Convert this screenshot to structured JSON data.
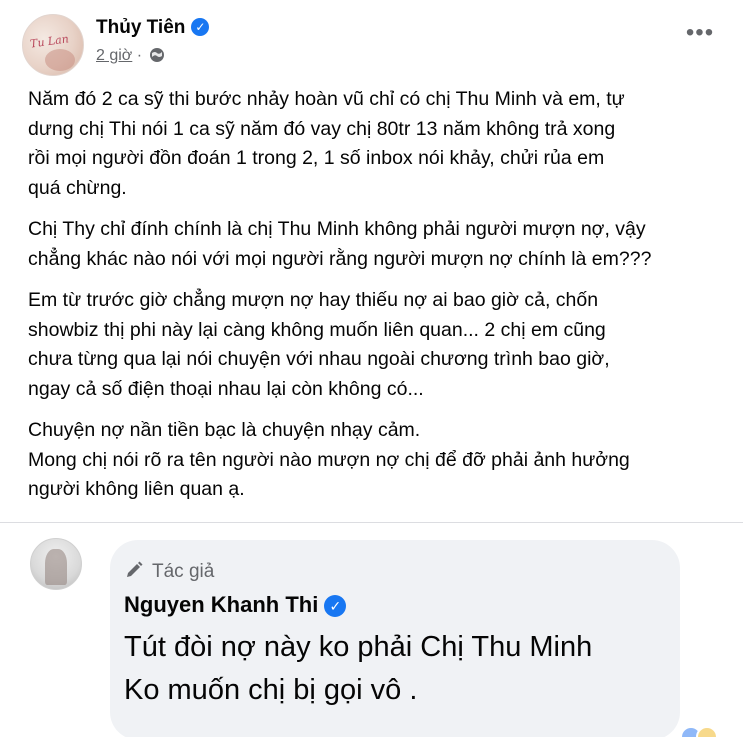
{
  "post": {
    "author": "Thủy Tiên",
    "time": "2 giờ",
    "separator": "·",
    "avatar_text": "Tu Lan",
    "paragraphs": [
      "Năm đó 2 ca sỹ thi bước nhảy hoàn vũ chỉ có chị Thu Minh và em, tự\ndưng chị Thi nói 1 ca sỹ năm đó vay chị 80tr 13 năm không trả xong\nrồi mọi người đồn đoán 1 trong 2, 1 số inbox nói khảy, chửi rủa em\nquá chừng.",
      "Chị Thy chỉ đính chính là chị Thu Minh không phải người mượn nợ, vậy\nchẳng khác nào nói với mọi người rằng người mượn nợ chính là em???",
      "Em từ trước giờ chẳng mượn nợ hay thiếu nợ ai bao giờ cả, chốn\nshowbiz thị phi này lại càng không muốn liên quan... 2 chị em cũng\nchưa từng qua lại nói chuyện với nhau ngoài chương trình bao giờ,\nngay cả số điện thoại nhau lại còn không có...",
      "Chuyện nợ nần tiền bạc là chuyện nhạy cảm.\nMong chị nói rõ ra tên người nào mượn nợ chị để đỡ phải ảnh hưởng\nngười không liên quan ạ."
    ],
    "more_label": "•••"
  },
  "comment": {
    "badge": "Tác giả",
    "author": "Nguyen Khanh Thi",
    "text": "Tút đòi nợ này ko phải Chị Thu Minh\nKo muốn chị bị gọi vô ."
  },
  "icons": {
    "verified": "checkmark-badge-icon",
    "globe": "globe-icon",
    "pencil": "pencil-icon",
    "more": "more-dots-icon"
  },
  "colors": {
    "verified_blue": "#1877f2",
    "meta_gray": "#65676b",
    "bubble_bg": "#f0f2f5"
  }
}
